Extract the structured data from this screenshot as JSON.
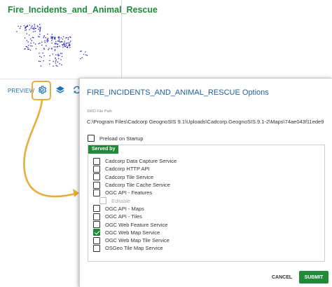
{
  "card": {
    "title": "Fire_Incidents_and_Animal_Rescue",
    "preview_label": "PREVIEW",
    "icons": [
      "gear-icon",
      "layers-icon",
      "refresh-icon"
    ]
  },
  "dialog": {
    "title": "FIRE_INCIDENTS_AND_ANIMAL_RESCUE Options",
    "swd_label": "SWD File Path",
    "swd_value": "C:\\Program Files\\Cadcorp GeognoSIS 9.1\\Uploads\\Cadcorp.GeognoSIS.9.1-2\\Maps\\74ae043f11ede9",
    "preload_label": "Preload on Startup",
    "preload_checked": false,
    "served_by_label": "Served by",
    "services": [
      {
        "label": "Cadcorp Data Capture Service",
        "checked": false
      },
      {
        "label": "Cadcorp HTTP API",
        "checked": false
      },
      {
        "label": "Cadcorp Tile Service",
        "checked": false
      },
      {
        "label": "Cadcorp Tile Cache Service",
        "checked": false
      },
      {
        "label": "OGC API - Features",
        "checked": false
      },
      {
        "label": "Editable",
        "checked": false,
        "disabled": true,
        "indent": true
      },
      {
        "label": "OGC API - Maps",
        "checked": false
      },
      {
        "label": "OGC API - Tiles",
        "checked": false
      },
      {
        "label": "OGC Web Feature Service",
        "checked": false
      },
      {
        "label": "OGC Web Map Service",
        "checked": true
      },
      {
        "label": "OGC Web Map Tile Service",
        "checked": false
      },
      {
        "label": "OSGeo Tile Map Service",
        "checked": false
      }
    ],
    "cancel_label": "CANCEL",
    "submit_label": "SUBMIT"
  },
  "colors": {
    "accent_green": "#1f8a3a",
    "title_blue": "#1f5f99",
    "link_blue": "#1a73b8",
    "highlight_orange": "#e9ad3a",
    "map_points": "#2222cc"
  }
}
